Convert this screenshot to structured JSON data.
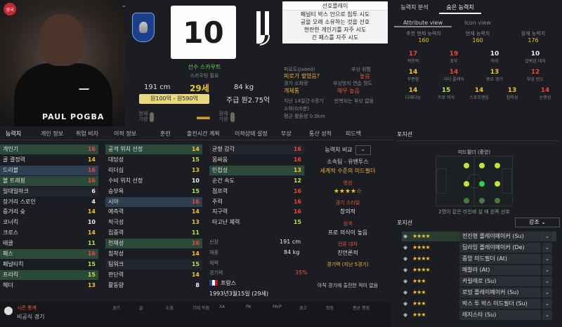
{
  "player": {
    "name": "PAUL POGBA",
    "number": "10",
    "height": "191 cm",
    "age": "29세",
    "weight": "84 kg",
    "value": "원100억 - 원590억",
    "wage": "주급 원2.75억",
    "scout_label": "선수 스카우트",
    "scout_need": "스카우팅 필요",
    "current_ability_label": "현재 기량",
    "potential_ability_label": "잠재 기량",
    "flag_badge": "영국",
    "france_badge": "FRANCE"
  },
  "traits": {
    "title": "선호플레이",
    "items": [
      "페널티 박스 안으로 침투 시도",
      "공을 오래 소유하는 것을 선호",
      "현란한 개인기를 자주 시도",
      "긴 패스를 자주 시도"
    ]
  },
  "status": {
    "injury_label": "피로도(Jaded)",
    "injury_val": "피로가 쌓였음?",
    "injury_risk_label": "부상 위험",
    "injury_risk_val": "높음",
    "sharpness_label": "경기 소화량",
    "sharpness_val": "개체통",
    "injury_prone_label": "부상방지 연습 정도",
    "injury_prone_val": "매우 높음",
    "last14_label": "지난 14일간 0경기",
    "last14_val": "반복되는 부상 없음",
    "minutes_label": "소화(0/0분)",
    "distance_label": "평균 활동량 0.0km"
  },
  "right_tabs": [
    "능력치 분석",
    "숨은 능력치"
  ],
  "right_sub_tabs": [
    "Attribute view",
    "Icon view"
  ],
  "right_summary": [
    {
      "label": "추천 현재 능력치",
      "value": "160"
    },
    {
      "label": "현재 능력치",
      "value": "160"
    },
    {
      "label": "잠재 능력치",
      "value": "176"
    }
  ],
  "hidden_attrs": [
    {
      "v": "17",
      "l": "적응력",
      "c": "red"
    },
    {
      "v": "19",
      "l": "포부",
      "c": "red"
    },
    {
      "v": "10",
      "l": "의리",
      "c": "white"
    },
    {
      "v": "10",
      "l": "압박감 대처",
      "c": "white"
    },
    {
      "v": "14",
      "l": "꾸준함",
      "c": "gold"
    },
    {
      "v": "14",
      "l": "더티 플레이",
      "c": "red"
    },
    {
      "v": "13",
      "l": "중요 경기",
      "c": "gold"
    },
    {
      "v": "12",
      "l": "부상 빈도",
      "c": "red"
    },
    {
      "v": "14",
      "l": "다재다능",
      "c": "gold"
    },
    {
      "v": "15",
      "l": "프로 의식",
      "c": "green"
    },
    {
      "v": "14",
      "l": "스포츠맨십",
      "c": "gold"
    },
    {
      "v": "13",
      "l": "침착성",
      "c": "gold"
    },
    {
      "v": "14",
      "l": "논쟁성",
      "c": "red"
    }
  ],
  "tabs": [
    "능력치",
    "개인 정보",
    "취업 비자",
    "이적 정보",
    "훈련",
    "출전시간 계획",
    "이적상태 설정",
    "부상",
    "통산 성적",
    "피드백"
  ],
  "attributes": {
    "col1": [
      {
        "n": "개인기",
        "v": "16",
        "c": "red"
      },
      {
        "n": "골 결정력",
        "v": "14",
        "c": "gold"
      },
      {
        "n": "드리블",
        "v": "16",
        "c": "red"
      },
      {
        "n": "볼 트래핑",
        "v": "16",
        "c": "red"
      },
      {
        "n": "일대일마크",
        "v": "6",
        "c": "white"
      },
      {
        "n": "장거리 스로인",
        "v": "4",
        "c": "white"
      },
      {
        "n": "중거리 슛",
        "v": "14",
        "c": "gold"
      },
      {
        "n": "코너킥",
        "v": "10",
        "c": "white"
      },
      {
        "n": "크로스",
        "v": "14",
        "c": "gold"
      },
      {
        "n": "태클",
        "v": "11",
        "c": "green"
      },
      {
        "n": "패스",
        "v": "16",
        "c": "red"
      },
      {
        "n": "페널티킥",
        "v": "15",
        "c": "green"
      },
      {
        "n": "프리킥",
        "v": "15",
        "c": "green"
      },
      {
        "n": "헤더",
        "v": "13",
        "c": "gold"
      }
    ],
    "col2": [
      {
        "n": "공격 위치 선정",
        "v": "14",
        "c": "gold"
      },
      {
        "n": "대담성",
        "v": "15",
        "c": "green"
      },
      {
        "n": "리더십",
        "v": "13",
        "c": "gold"
      },
      {
        "n": "수비 위치 선정",
        "v": "10",
        "c": "white"
      },
      {
        "n": "승부욕",
        "v": "15",
        "c": "green"
      },
      {
        "n": "시야",
        "v": "16",
        "c": "red"
      },
      {
        "n": "예측력",
        "v": "14",
        "c": "gold"
      },
      {
        "n": "적극성",
        "v": "13",
        "c": "gold"
      },
      {
        "n": "집중력",
        "v": "11",
        "c": "green"
      },
      {
        "n": "천재성",
        "v": "16",
        "c": "red"
      },
      {
        "n": "침착성",
        "v": "14",
        "c": "gold"
      },
      {
        "n": "팀워크",
        "v": "15",
        "c": "green"
      },
      {
        "n": "판단력",
        "v": "14",
        "c": "gold"
      },
      {
        "n": "활동량",
        "v": "8",
        "c": "white"
      }
    ],
    "col3": [
      {
        "n": "균형 감각",
        "v": "16",
        "c": "red"
      },
      {
        "n": "몸싸움",
        "v": "16",
        "c": "red"
      },
      {
        "n": "민첩성",
        "v": "13",
        "c": "gold"
      },
      {
        "n": "순간 속도",
        "v": "12",
        "c": "green"
      },
      {
        "n": "점프력",
        "v": "16",
        "c": "red"
      },
      {
        "n": "주력",
        "v": "16",
        "c": "red"
      },
      {
        "n": "지구력",
        "v": "16",
        "c": "red"
      },
      {
        "n": "타고난 체력",
        "v": "15",
        "c": "green"
      }
    ]
  },
  "physical_info": {
    "height_label": "신장",
    "height_val": "191 cm",
    "weight_label": "체중",
    "weight_val": "84 kg",
    "fitness_label": "체력",
    "fitness_val": "",
    "sharpness_label": "경기력",
    "sharpness_val": "35%",
    "nation_val": "프랑스",
    "dob": "1993년3월15일 (29세)"
  },
  "profile": {
    "compare_label": "능력치 비교",
    "club_label": "소속팀 - 유벤투스",
    "desc": "세계적 수준의 미드필더",
    "reputation_label": "명성",
    "stars": "★★★★☆",
    "style_label": "경기 스타일",
    "style_val": "창의적",
    "personality_label": "성격",
    "personality_val": "프로 의식이 높음",
    "media_label": "언론 대처",
    "media_val": "친언론적",
    "form_label": "경기력 (지난 5경기)",
    "no_matches": "아직 경기에 출전한 적이 없음"
  },
  "stats_bar": {
    "title": "시즌 통계",
    "sub": "비공식 경기",
    "headers": [
      "경기",
      "골",
      "도움",
      "기대 득점",
      "XA",
      "PK",
      "MVP",
      "경고",
      "퇴장",
      "평균 평점"
    ]
  },
  "positions": {
    "header": "포지션",
    "pos_name": "미드필더 (중앙)",
    "note": "2명이 같은 라인에 설 때 왼쪽 선호",
    "role_label": "포지션",
    "strength_label": "강조",
    "roles": [
      {
        "stars": "★★★★",
        "name": "전진형 플레이메이커 (Su)"
      },
      {
        "stars": "★★★★",
        "name": "딥라잉 플레이메이커 (De)"
      },
      {
        "stars": "★★★★",
        "name": "중앙 미드필더 (At)"
      },
      {
        "stars": "★★★★",
        "name": "메찰라 (At)"
      },
      {
        "stars": "★★★",
        "name": "카릴레로 (Su)"
      },
      {
        "stars": "★★★",
        "name": "로밍 플레이메이커 (Su)"
      },
      {
        "stars": "★★★",
        "name": "박스 투 박스 미드필더 (Su)"
      },
      {
        "stars": "★★★",
        "name": "레지스타 (Su)"
      }
    ]
  }
}
